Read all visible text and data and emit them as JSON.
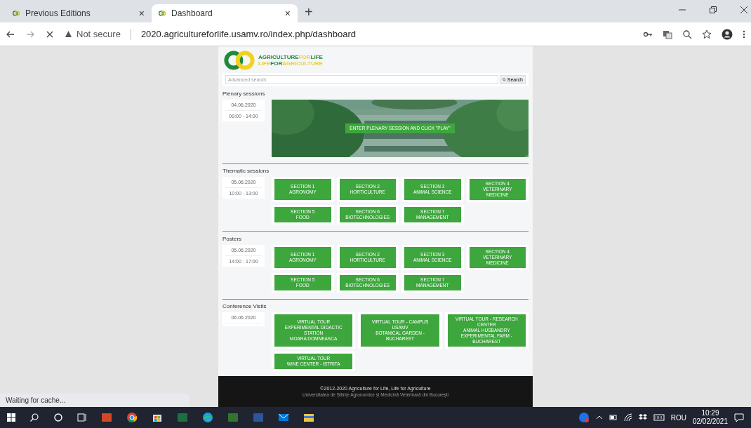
{
  "browser": {
    "tabs": [
      {
        "title": "Previous Editions",
        "selected": false,
        "close": "×"
      },
      {
        "title": "Dashboard",
        "selected": true,
        "close": "×"
      }
    ],
    "new_tab": "+",
    "security": "Not secure",
    "url": "2020.agricultureforlife.usamv.ro/index.php/dashboard",
    "status": "Waiting for cache..."
  },
  "page": {
    "logo": [
      [
        {
          "text": "AGRICULTURE",
          "color": "#1f8a3a"
        },
        {
          "text": "FOR",
          "color": "#f2d21b"
        },
        {
          "text": "LIFE",
          "color": "#1f8a3a"
        }
      ],
      [
        {
          "text": "LIFE",
          "color": "#f2d21b"
        },
        {
          "text": "FOR",
          "color": "#1f8a3a"
        },
        {
          "text": "AGRICULTURE",
          "color": "#f2d21b"
        }
      ]
    ],
    "search": {
      "placeholder": "Advanced search",
      "button": "Search"
    },
    "sections": [
      {
        "title": "Plenary sessions",
        "date": "04.06.2020",
        "time": "09:00 - 14:00",
        "kind": "banner",
        "banner_button": "ENTER PLENARY SESSION AND CLICK \"PLAY\""
      },
      {
        "title": "Thematic sessions",
        "date": "05.06.2020",
        "time": "10:00 - 13:00",
        "kind": "buttons",
        "buttons": [
          {
            "lines": [
              "SECTION 1",
              "AGRONOMY"
            ]
          },
          {
            "lines": [
              "SECTION 2",
              "HORTICULTURE"
            ]
          },
          {
            "lines": [
              "SECTION 3",
              "ANIMAL SCIENCE"
            ]
          },
          {
            "lines": [
              "SECTION 4",
              "VETERINARY MEDICINE"
            ]
          },
          {
            "lines": [
              "SECTION 5",
              "FOOD"
            ]
          },
          {
            "lines": [
              "SECTION 6",
              "BIOTECHNOLOGIES"
            ]
          },
          {
            "lines": [
              "SECTION 7",
              "MANAGEMENT"
            ]
          }
        ]
      },
      {
        "title": "Posters",
        "date": "05.06.2020",
        "time": "14:00 - 17:00",
        "kind": "buttons",
        "buttons": [
          {
            "lines": [
              "SECTION 1",
              "AGRONOMY"
            ]
          },
          {
            "lines": [
              "SECTION 2",
              "HORTICULTURE"
            ]
          },
          {
            "lines": [
              "SECTION 3",
              "ANIMAL SCIENCE"
            ]
          },
          {
            "lines": [
              "SECTION 4",
              "VETERINARY MEDICINE"
            ]
          },
          {
            "lines": [
              "SECTION 5",
              "FOOD"
            ]
          },
          {
            "lines": [
              "SECTION 6",
              "BIOTECHNOLOGIES"
            ]
          },
          {
            "lines": [
              "SECTION 7",
              "MANAGEMENT"
            ]
          }
        ]
      },
      {
        "title": "Conference Visits",
        "date": "06.06.2020",
        "kind": "visits",
        "buttons": [
          {
            "lines": [
              "VIRTUAL TOUR",
              "EXPERIMENTAL DIDACTIC STATION",
              "MOARA DOMNEASCA"
            ]
          },
          {
            "lines": [
              "VIRTUAL TOUR - CAMPUS USAMV",
              "BOTANICAL GARDEN - BUCHAREST"
            ]
          },
          {
            "lines": [
              "VIRTUAL TOUR - RESEARCH CENTER",
              "ANIMAL HUSBANDRY",
              "EXPERIMENTAL FARM - BUCHAREST"
            ]
          },
          {
            "lines": [
              "VIRTUAL TOUR",
              "WINE CENTER - ISTRITA"
            ]
          }
        ]
      }
    ],
    "footer": {
      "copyright": "©2012-2020 Agriculture for Life, Life for Agriculture",
      "university": "Universitatea de Științe Agronomice și Medicină Veterinară din București"
    }
  },
  "taskbar": {
    "language": "ROU",
    "time": "10:29",
    "date": "02/02/2021"
  }
}
